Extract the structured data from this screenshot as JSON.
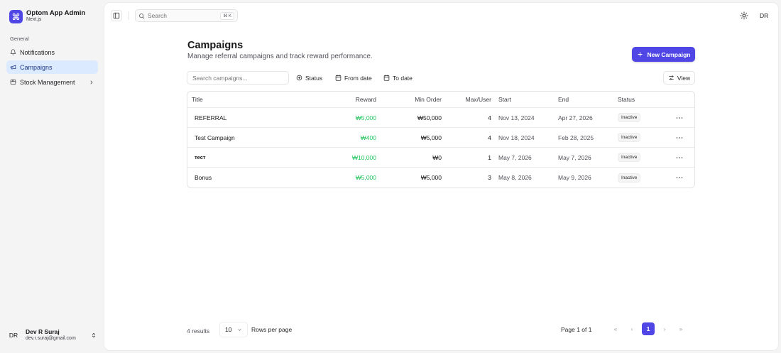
{
  "app": {
    "title": "Optom App Admin",
    "subtitle": "Next.js",
    "brand_color": "#4f46e5"
  },
  "sidebar": {
    "group_label": "General",
    "items": [
      {
        "label": "Notifications",
        "icon": "bell-icon",
        "active": false
      },
      {
        "label": "Campaigns",
        "icon": "megaphone-icon",
        "active": true
      },
      {
        "label": "Stock Management",
        "icon": "package-icon",
        "active": false,
        "has_submenu": true
      }
    ],
    "user": {
      "initials": "DR",
      "name": "Dev R Suraj",
      "email": "dev.r.suraj@gmail.com"
    }
  },
  "topbar": {
    "search_placeholder": "Search",
    "search_shortcut": "⌘ K",
    "user_initials": "DR"
  },
  "page": {
    "title": "Campaigns",
    "subtitle": "Manage referral campaigns and track reward performance.",
    "new_button_label": "New Campaign"
  },
  "filters": {
    "search_placeholder": "Search campaigns...",
    "status_label": "Status",
    "from_date_label": "From date",
    "to_date_label": "To date",
    "view_label": "View"
  },
  "table": {
    "columns": {
      "title": "Title",
      "reward": "Reward",
      "min_order": "Min Order",
      "max_user": "Max/User",
      "start": "Start",
      "end": "End",
      "status": "Status"
    },
    "rows": [
      {
        "title": "REFERRAL",
        "reward": "₩5,000",
        "min_order": "₩50,000",
        "max_user": "4",
        "start": "Nov 13, 2024",
        "end": "Apr 27, 2026",
        "status": "Inactive"
      },
      {
        "title": "Test Campaign",
        "reward": "₩400",
        "min_order": "₩5,000",
        "max_user": "4",
        "start": "Nov 18, 2024",
        "end": "Feb 28, 2025",
        "status": "Inactive"
      },
      {
        "title": "тест",
        "reward": "₩10,000",
        "min_order": "₩0",
        "max_user": "1",
        "start": "May 7, 2026",
        "end": "May 7, 2026",
        "status": "Inactive"
      },
      {
        "title": "Bonus",
        "reward": "₩5,000",
        "min_order": "₩5,000",
        "max_user": "3",
        "start": "May 8, 2026",
        "end": "May 9, 2026",
        "status": "Inactive"
      }
    ]
  },
  "pagination": {
    "results_text": "4 results",
    "rows_per_page_value": "10",
    "rows_per_page_label": "Rows per page",
    "page_info": "Page 1 of 1",
    "current_page": "1",
    "first_glyph": "«",
    "prev_glyph": "‹",
    "next_glyph": "›",
    "last_glyph": "»"
  },
  "colors": {
    "reward_green": "#22c55e",
    "active_nav_bg": "#dbeafe"
  }
}
